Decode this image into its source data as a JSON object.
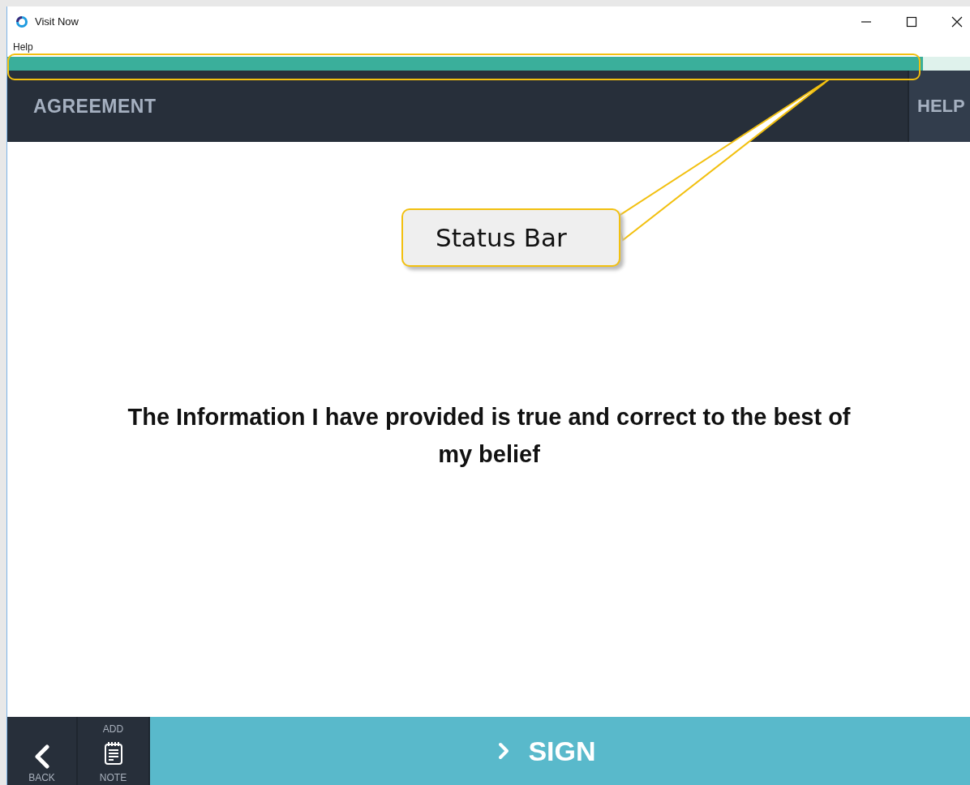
{
  "window": {
    "title": "Visit Now"
  },
  "menu": [
    "Help"
  ],
  "status_bar": {
    "level": 0.95
  },
  "header": {
    "title": "AGREEMENT",
    "help": "HELP"
  },
  "statement": "The Information I have provided is true and correct to the best of my belief",
  "footer": {
    "back": "BACK",
    "note_top": "ADD",
    "note_bottom": "NOTE",
    "sign": "SIGN"
  },
  "callout": {
    "label": "Status Bar"
  }
}
